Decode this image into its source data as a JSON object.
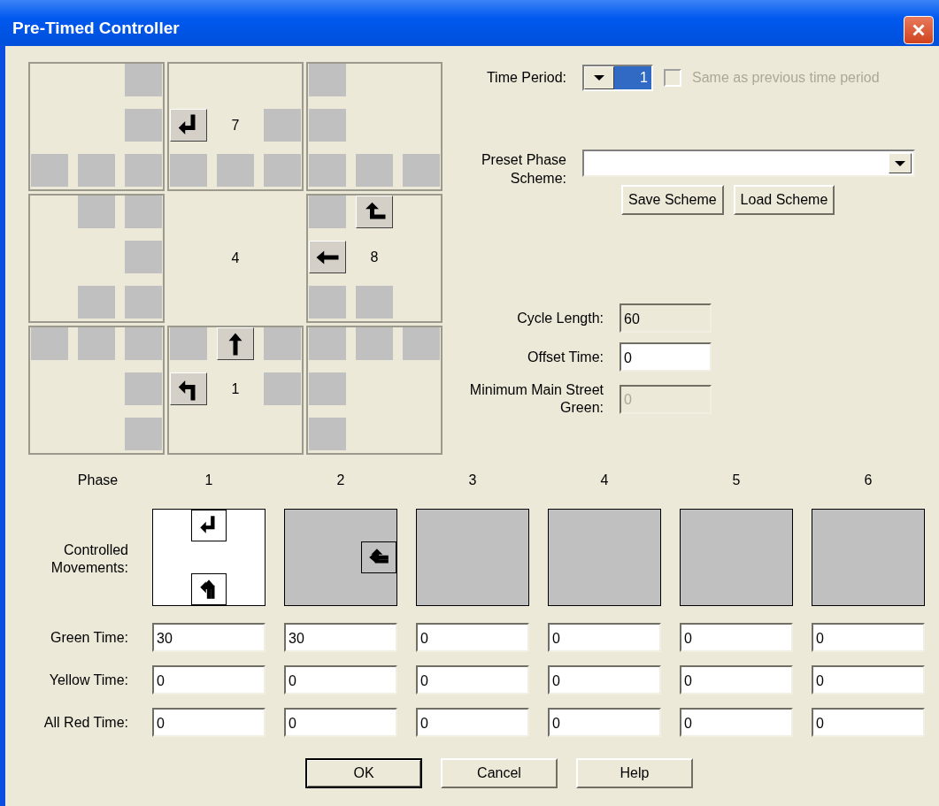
{
  "window": {
    "title": "Pre-Timed Controller"
  },
  "intersection": {
    "center_label": "4",
    "approaches": [
      {
        "kind": "north",
        "label": "7",
        "movements": [
          {
            "kind": "left"
          }
        ]
      },
      {
        "kind": "east",
        "label": "8",
        "movements": [
          {
            "kind": "left"
          },
          {
            "kind": "through"
          }
        ]
      },
      {
        "kind": "south",
        "label": "1",
        "movements": [
          {
            "kind": "through"
          },
          {
            "kind": "left"
          }
        ]
      }
    ]
  },
  "time_period": {
    "label": "Time Period:",
    "value": "1",
    "same_as_previous": {
      "label": "Same as previous time period",
      "checked": false,
      "disabled": true
    }
  },
  "preset_scheme": {
    "label": "Preset Phase Scheme:",
    "buttons": [
      "Save Scheme",
      "Load Scheme"
    ]
  },
  "fields": [
    {
      "label": "Cycle Length:",
      "value": "60",
      "readonly": true,
      "disabled": false
    },
    {
      "label": "Offset Time:",
      "value": "0",
      "readonly": false,
      "disabled": false
    },
    {
      "label": "Minimum Main Street Green:",
      "value": "0",
      "readonly": false,
      "disabled": true
    }
  ],
  "phase_table": {
    "phase_label": "Phase",
    "movements_label": "Controlled Movements:",
    "time_labels": [
      "Green Time:",
      "Yellow Time:",
      "All Red Time:"
    ],
    "phases": [
      {
        "label": "1",
        "selected": true,
        "movements": [
          {
            "kind": "north",
            "turns": [
              {
                "kind": "left"
              }
            ]
          },
          {
            "kind": "south",
            "turns": [
              {
                "kind": "left"
              },
              {
                "kind": "through"
              }
            ]
          }
        ],
        "times": [
          "30",
          "0",
          "0"
        ]
      },
      {
        "label": "2",
        "selected": false,
        "movements": [
          {
            "kind": "east",
            "turns": [
              {
                "kind": "left"
              },
              {
                "kind": "through"
              }
            ]
          }
        ],
        "times": [
          "30",
          "0",
          "0"
        ]
      },
      {
        "label": "3",
        "selected": false,
        "times": [
          "0",
          "0",
          "0"
        ]
      },
      {
        "label": "4",
        "selected": false,
        "times": [
          "0",
          "0",
          "0"
        ]
      },
      {
        "label": "5",
        "selected": false,
        "times": [
          "0",
          "0",
          "0"
        ]
      },
      {
        "label": "6",
        "selected": false,
        "times": [
          "0",
          "0",
          "0"
        ]
      }
    ]
  },
  "dialog_buttons": [
    {
      "label": "OK",
      "default": true
    },
    {
      "label": "Cancel",
      "default": false
    },
    {
      "label": "Help",
      "default": false
    }
  ]
}
